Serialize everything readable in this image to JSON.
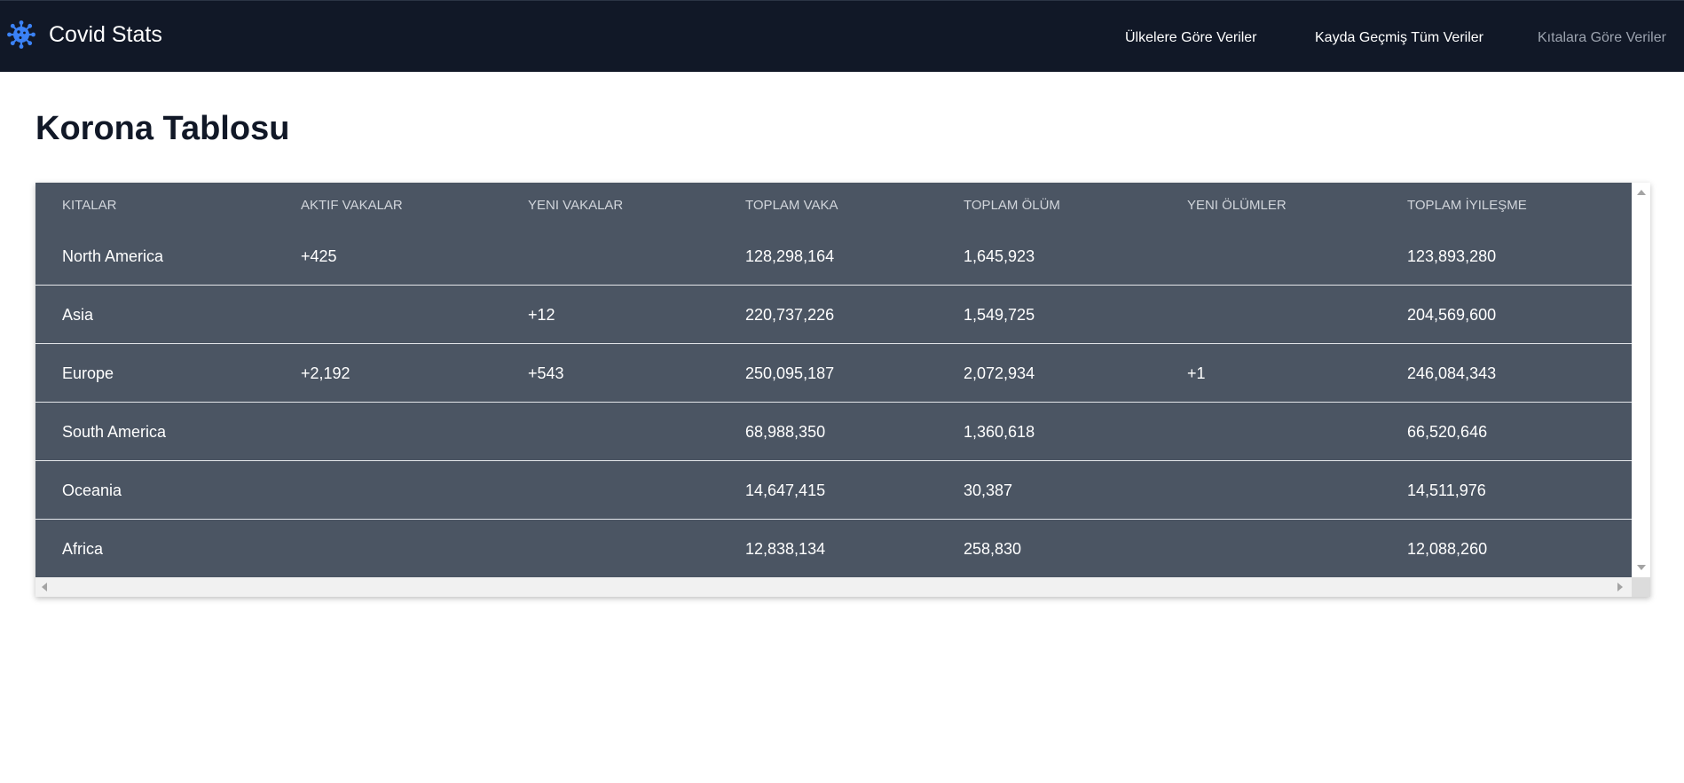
{
  "navbar": {
    "brand_title": "Covid Stats",
    "brand_icon": "virus-icon",
    "links": [
      {
        "label": "Ülkelere Göre Veriler"
      },
      {
        "label": "Kayda Geçmiş Tüm Veriler"
      },
      {
        "label": "Kıtalara Göre Veriler"
      }
    ]
  },
  "page": {
    "title": "Korona Tablosu"
  },
  "table": {
    "headers": [
      "KITALAR",
      "AKTIF VAKALAR",
      "YENI VAKALAR",
      "TOPLAM VAKA",
      "TOPLAM ÖLÜM",
      "YENI ÖLÜMLER",
      "TOPLAM İYILEŞME"
    ],
    "rows": [
      [
        "North America",
        "+425",
        "",
        "128,298,164",
        "1,645,923",
        "",
        "123,893,280"
      ],
      [
        "Asia",
        "",
        "+12",
        "220,737,226",
        "1,549,725",
        "",
        "204,569,600"
      ],
      [
        "Europe",
        "+2,192",
        "+543",
        "250,095,187",
        "2,072,934",
        "+1",
        "246,084,343"
      ],
      [
        "South America",
        "",
        "",
        "68,988,350",
        "1,360,618",
        "",
        "66,520,646"
      ],
      [
        "Oceania",
        "",
        "",
        "14,647,415",
        "30,387",
        "",
        "14,511,976"
      ],
      [
        "Africa",
        "",
        "",
        "12,838,134",
        "258,830",
        "",
        "12,088,260"
      ]
    ]
  },
  "colors": {
    "navbar_bg": "#111827",
    "table_bg": "#4b5563",
    "brand_icon": "#3b82f6",
    "inactive_link": "#9ca3af"
  }
}
